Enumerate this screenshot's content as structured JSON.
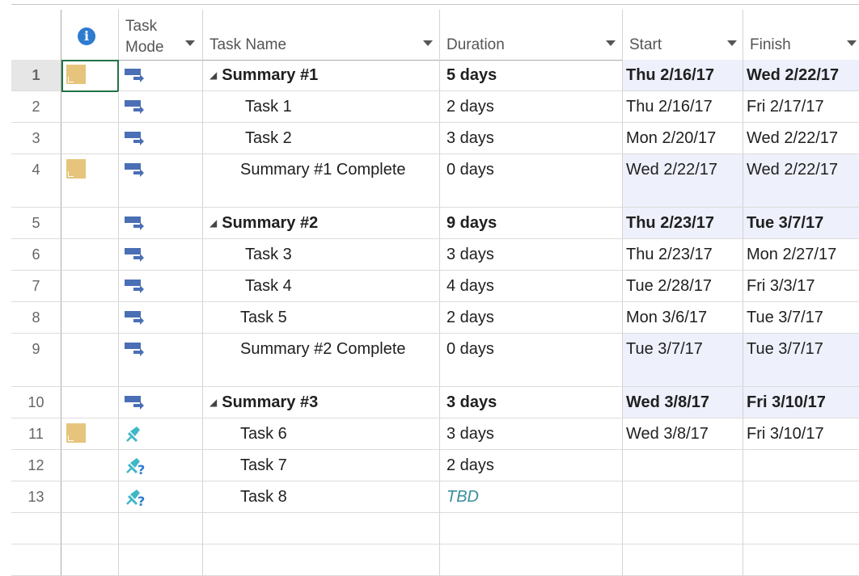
{
  "header": {
    "info_glyph": "i",
    "mode_label_line1": "Task",
    "mode_label_line2": "Mode",
    "name_label": "Task Name",
    "duration_label": "Duration",
    "start_label": "Start",
    "finish_label": "Finish"
  },
  "rows": [
    {
      "num": "1",
      "note": true,
      "mode": "auto",
      "name": "Summary #1",
      "summary": true,
      "indent": "summary",
      "duration": "5 days",
      "start": "Thu 2/16/17",
      "finish": "Wed 2/22/17",
      "selected": true,
      "shade": true,
      "tall": false
    },
    {
      "num": "2",
      "note": false,
      "mode": "auto",
      "name": "Task 1",
      "summary": false,
      "indent": "child",
      "duration": "2 days",
      "start": "Thu 2/16/17",
      "finish": "Fri 2/17/17",
      "selected": false,
      "shade": false,
      "tall": false
    },
    {
      "num": "3",
      "note": false,
      "mode": "auto",
      "name": "Task 2",
      "summary": false,
      "indent": "child",
      "duration": "3 days",
      "start": "Mon 2/20/17",
      "finish": "Wed 2/22/17",
      "selected": false,
      "shade": false,
      "tall": false
    },
    {
      "num": "4",
      "note": true,
      "mode": "auto",
      "name": "Summary #1 Complete",
      "summary": false,
      "indent": "milestone",
      "duration": "0 days",
      "start": "Wed 2/22/17",
      "finish": "Wed 2/22/17",
      "selected": false,
      "shade": true,
      "tall": true
    },
    {
      "num": "5",
      "note": false,
      "mode": "auto",
      "name": "Summary #2",
      "summary": true,
      "indent": "summary",
      "duration": "9 days",
      "start": "Thu 2/23/17",
      "finish": "Tue 3/7/17",
      "selected": false,
      "shade": true,
      "tall": false
    },
    {
      "num": "6",
      "note": false,
      "mode": "auto",
      "name": "Task 3",
      "summary": false,
      "indent": "child",
      "duration": "3 days",
      "start": "Thu 2/23/17",
      "finish": "Mon 2/27/17",
      "selected": false,
      "shade": false,
      "tall": false
    },
    {
      "num": "7",
      "note": false,
      "mode": "auto",
      "name": "Task 4",
      "summary": false,
      "indent": "child",
      "duration": "4 days",
      "start": "Tue 2/28/17",
      "finish": "Fri 3/3/17",
      "selected": false,
      "shade": false,
      "tall": false
    },
    {
      "num": "8",
      "note": false,
      "mode": "auto",
      "name": "Task 5",
      "summary": false,
      "indent": "milestone",
      "duration": "2 days",
      "start": "Mon 3/6/17",
      "finish": "Tue 3/7/17",
      "selected": false,
      "shade": false,
      "tall": false
    },
    {
      "num": "9",
      "note": false,
      "mode": "auto",
      "name": "Summary #2 Complete",
      "summary": false,
      "indent": "milestone",
      "duration": "0 days",
      "start": "Tue 3/7/17",
      "finish": "Tue 3/7/17",
      "selected": false,
      "shade": true,
      "tall": true
    },
    {
      "num": "10",
      "note": false,
      "mode": "auto",
      "name": "Summary #3",
      "summary": true,
      "indent": "summary",
      "duration": "3 days",
      "start": "Wed 3/8/17",
      "finish": "Fri 3/10/17",
      "selected": false,
      "shade": true,
      "tall": false
    },
    {
      "num": "11",
      "note": true,
      "mode": "manual",
      "name": "Task 6",
      "summary": false,
      "indent": "milestone",
      "duration": "3 days",
      "start": "Wed 3/8/17",
      "finish": "Fri 3/10/17",
      "selected": false,
      "shade": false,
      "tall": false
    },
    {
      "num": "12",
      "note": false,
      "mode": "manual-unknown",
      "name": "Task 7",
      "summary": false,
      "indent": "milestone",
      "duration": "2 days",
      "start": "",
      "finish": "",
      "selected": false,
      "shade": false,
      "tall": false
    },
    {
      "num": "13",
      "note": false,
      "mode": "manual-unknown",
      "name": "Task 8",
      "summary": false,
      "indent": "milestone",
      "duration": "TBD",
      "durationTbd": true,
      "start": "",
      "finish": "",
      "selected": false,
      "shade": false,
      "tall": false
    },
    {
      "num": "",
      "note": false,
      "mode": "",
      "name": "",
      "summary": false,
      "indent": "child",
      "duration": "",
      "start": "",
      "finish": "",
      "selected": false,
      "shade": false,
      "tall": false,
      "empty": true
    },
    {
      "num": "",
      "note": false,
      "mode": "",
      "name": "",
      "summary": false,
      "indent": "child",
      "duration": "",
      "start": "",
      "finish": "",
      "selected": false,
      "shade": false,
      "tall": false,
      "empty": true
    }
  ],
  "colors": {
    "accent_selection": "#217346",
    "shade": "#eef0fb",
    "note": "#e6c47c",
    "auto_icon": "#4a6fb5",
    "manual_icon": "#3fb7c6",
    "tbd": "#3a8e9e"
  },
  "icons": {
    "info": "info-icon",
    "note": "note-icon",
    "auto": "auto-schedule-icon",
    "manual": "manual-schedule-pin-icon",
    "manual_unknown": "manual-schedule-unknown-icon",
    "summary_toggle": "collapse-triangle-icon"
  }
}
